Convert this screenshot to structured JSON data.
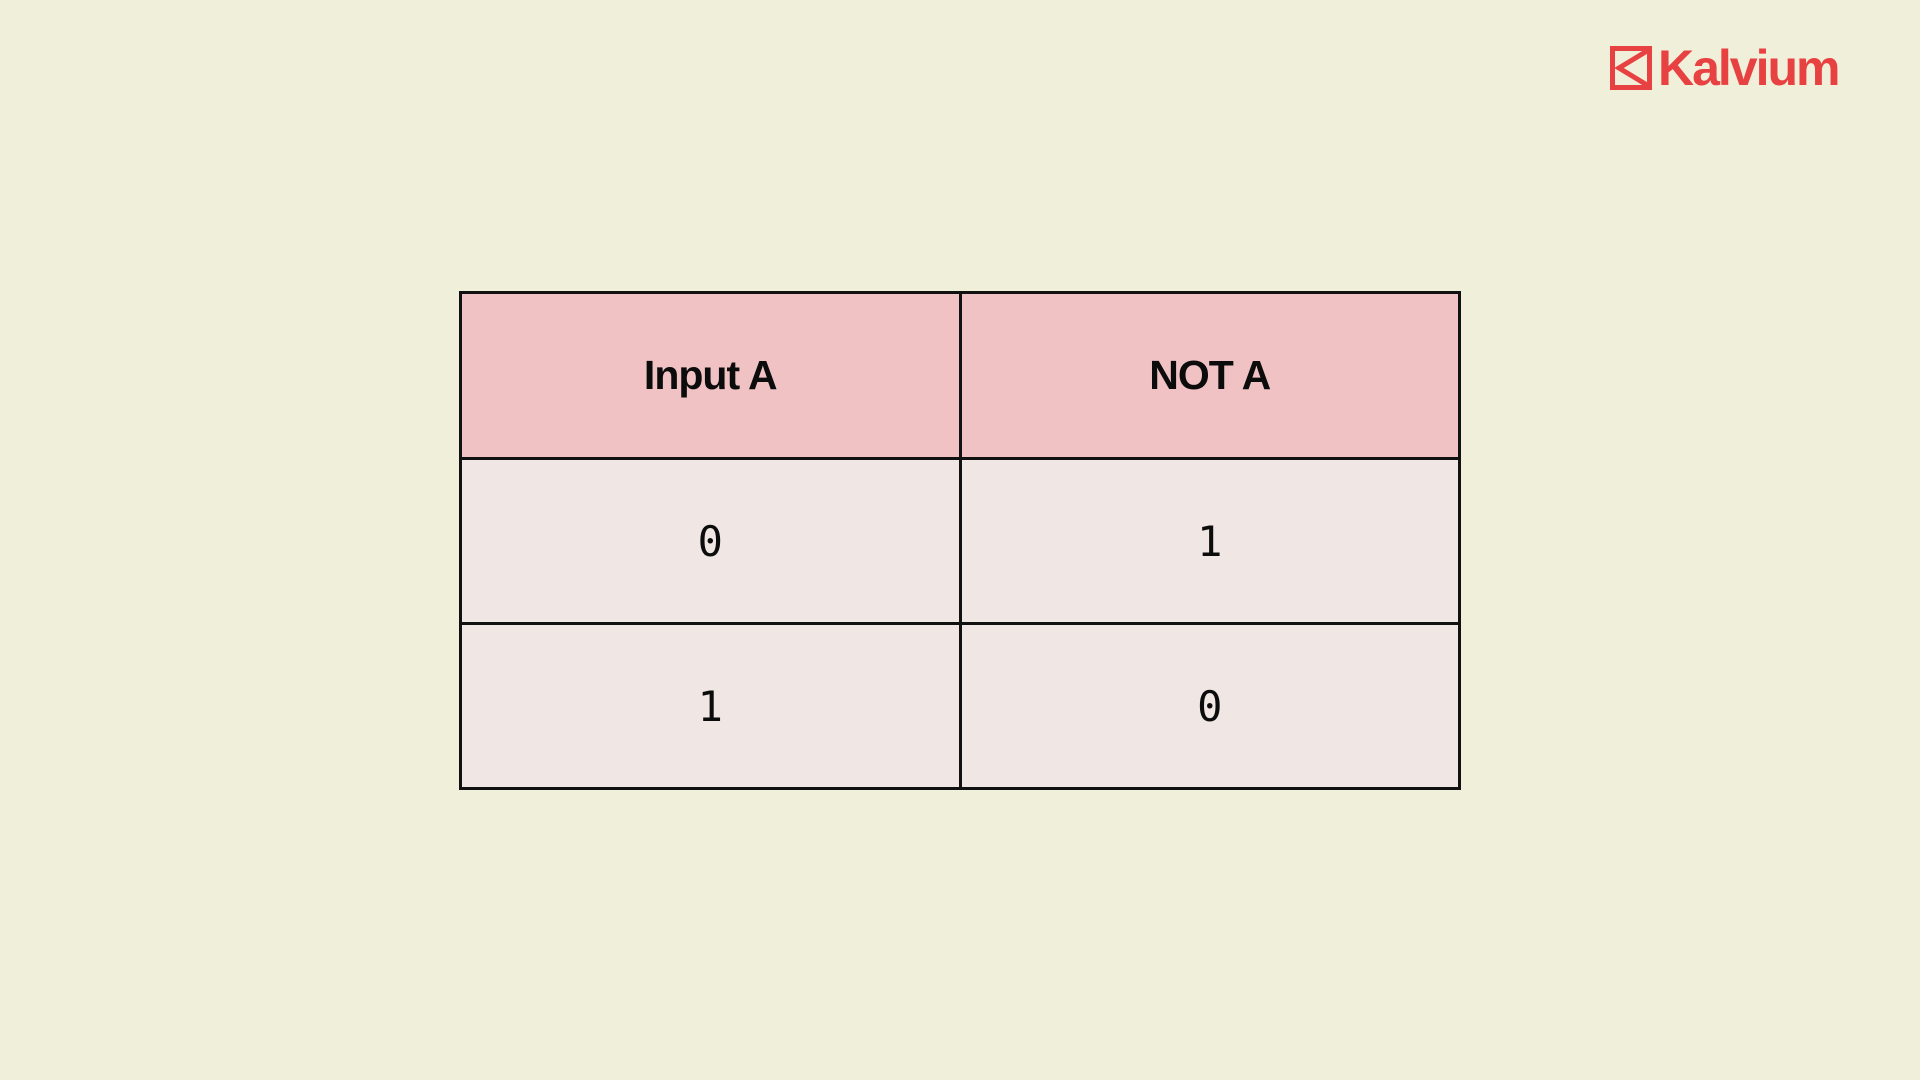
{
  "brand": {
    "name": "Kalvium",
    "logo_icon": "kalvium-logo-icon",
    "color": "#e84141"
  },
  "table": {
    "headers": [
      "Input A",
      "NOT A"
    ],
    "rows": [
      [
        "0",
        "1"
      ],
      [
        "1",
        "0"
      ]
    ]
  },
  "colors": {
    "background": "#f0efda",
    "header_fill": "#f0c2c4",
    "cell_fill": "#f0e6e4",
    "border": "#111111"
  }
}
